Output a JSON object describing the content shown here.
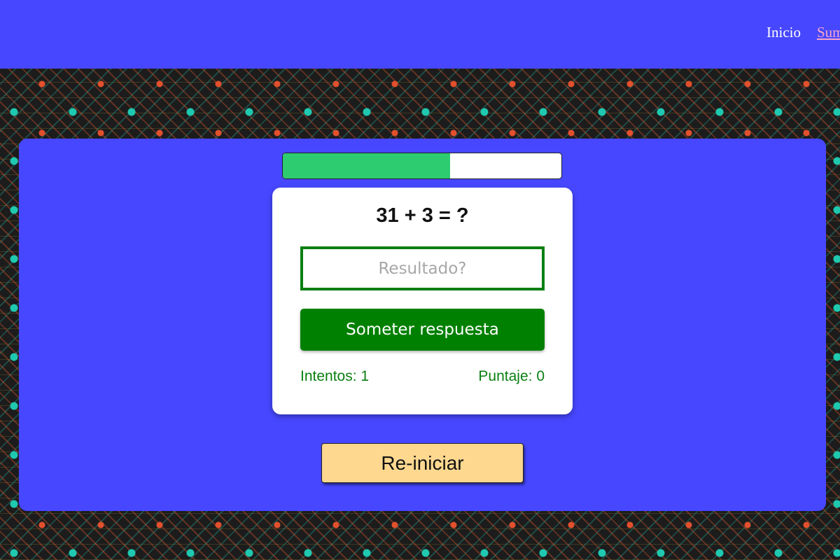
{
  "nav": {
    "home_label": "Inicio",
    "sum_label": "Suma"
  },
  "progress": {
    "fraction": 0.6,
    "fill_color": "#2ecc71"
  },
  "quiz": {
    "question": "31 + 3 = ?",
    "answer_value": "",
    "answer_placeholder": "Resultado?",
    "submit_label": "Someter respuesta",
    "attempts_text": "Intentos: 1",
    "score_text": "Puntaje: 0"
  },
  "restart_label": "Re-iniciar",
  "colors": {
    "nav_background": "#4747ff",
    "panel_background": "#4747ff",
    "accent_green": "#008000",
    "restart_background": "#ffd890"
  }
}
